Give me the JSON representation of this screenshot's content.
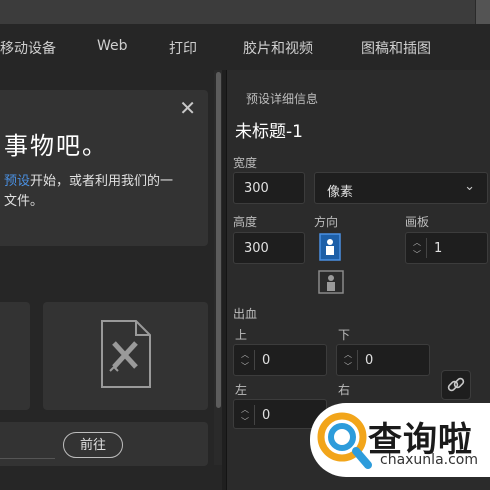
{
  "tabs": [
    "移动设备",
    "Web",
    "打印",
    "胶片和视频",
    "图稿和插图"
  ],
  "welcome": {
    "heading": "事物吧。",
    "line1_link": "预设",
    "line1_rest": "开始，或者利用我们的一",
    "line2": "文件。",
    "close_icon": "close-icon"
  },
  "goto_button": "前往",
  "preset": {
    "section_label": "预设详细信息",
    "title": "未标题-1",
    "width_label": "宽度",
    "width_value": "300",
    "unit_value": "像素",
    "height_label": "高度",
    "height_value": "300",
    "orientation_label": "方向",
    "artboards_label": "画板",
    "artboards_value": "1",
    "bleed_label": "出血",
    "bleed_top_label": "上",
    "bleed_top_value": "0",
    "bleed_bottom_label": "下",
    "bleed_bottom_value": "0",
    "bleed_left_label": "左",
    "bleed_left_value": "0",
    "bleed_right_label": "右"
  },
  "watermark": {
    "brand": "查询啦",
    "domain": "chaxunla.com"
  },
  "colors": {
    "accent": "#4a90e2",
    "panel": "#2b2b2b",
    "field": "#1e1e1e"
  }
}
